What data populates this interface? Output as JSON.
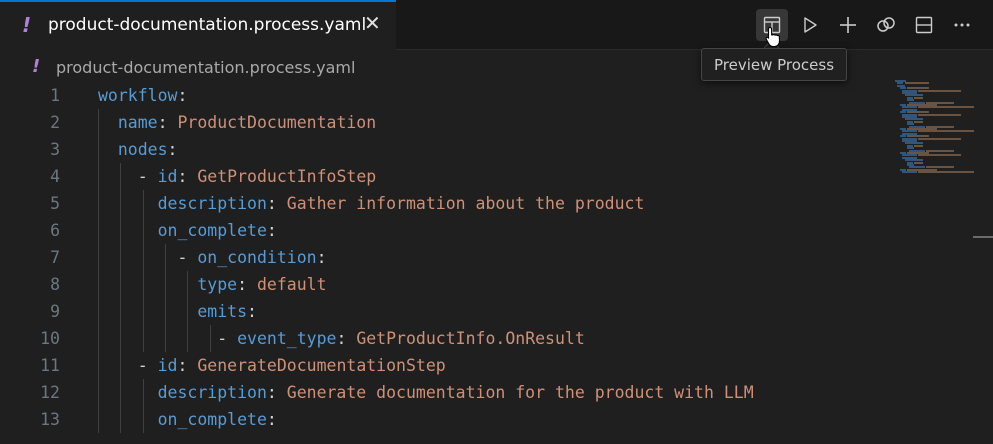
{
  "tab": {
    "modified_marker": "!",
    "title": "product-documentation.process.yaml",
    "close_glyph": "✕"
  },
  "actions": [
    {
      "name": "preview-process",
      "icon": "preview-icon"
    },
    {
      "name": "run",
      "icon": "play-icon"
    },
    {
      "name": "add",
      "icon": "plus-icon"
    },
    {
      "name": "link",
      "icon": "link-icon"
    },
    {
      "name": "split-editor",
      "icon": "split-editor-icon"
    },
    {
      "name": "more-actions",
      "icon": "ellipsis-icon"
    }
  ],
  "tooltip": "Preview Process",
  "breadcrumb": {
    "marker": "!",
    "file": "product-documentation.process.yaml"
  },
  "code_lines": [
    {
      "n": "1",
      "indent": "",
      "dash": "",
      "key": "workflow",
      "value": ""
    },
    {
      "n": "2",
      "indent": "  ",
      "dash": "",
      "key": "name",
      "value": "ProductDocumentation"
    },
    {
      "n": "3",
      "indent": "  ",
      "dash": "",
      "key": "nodes",
      "value": ""
    },
    {
      "n": "4",
      "indent": "    ",
      "dash": "- ",
      "key": "id",
      "value": "GetProductInfoStep"
    },
    {
      "n": "5",
      "indent": "      ",
      "dash": "",
      "key": "description",
      "value": "Gather information about the product"
    },
    {
      "n": "6",
      "indent": "      ",
      "dash": "",
      "key": "on_complete",
      "value": ""
    },
    {
      "n": "7",
      "indent": "        ",
      "dash": "- ",
      "key": "on_condition",
      "value": ""
    },
    {
      "n": "8",
      "indent": "          ",
      "dash": "",
      "key": "type",
      "value": "default"
    },
    {
      "n": "9",
      "indent": "          ",
      "dash": "",
      "key": "emits",
      "value": ""
    },
    {
      "n": "10",
      "indent": "            ",
      "dash": "- ",
      "key": "event_type",
      "value": "GetProductInfo.OnResult"
    },
    {
      "n": "11",
      "indent": "    ",
      "dash": "- ",
      "key": "id",
      "value": "GenerateDocumentationStep"
    },
    {
      "n": "12",
      "indent": "      ",
      "dash": "",
      "key": "description",
      "value": "Generate documentation for the product with LLM"
    },
    {
      "n": "13",
      "indent": "      ",
      "dash": "",
      "key": "on_complete",
      "value": ""
    }
  ],
  "colors": {
    "key": "#569cd6",
    "value": "#ce9178",
    "punctuation": "#d4d4d4",
    "line_number": "#6e7681",
    "yaml_marker": "#b180d7",
    "tab_active_border": "#0078d4"
  }
}
